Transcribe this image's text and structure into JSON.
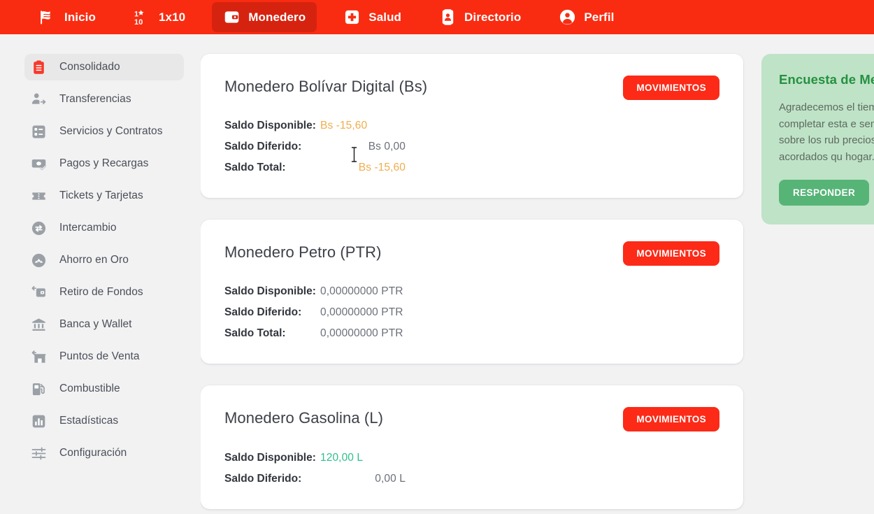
{
  "topnav": {
    "background": "#f92c11",
    "active_background": "#d62310",
    "items": [
      {
        "label": "Inicio",
        "icon": "flag-icon",
        "active": false
      },
      {
        "label": "1x10",
        "icon": "one-by-ten-icon",
        "active": false
      },
      {
        "label": "Monedero",
        "icon": "wallet-icon",
        "active": true
      },
      {
        "label": "Salud",
        "icon": "medical-cross-icon",
        "active": false
      },
      {
        "label": "Directorio",
        "icon": "id-card-icon",
        "active": false
      },
      {
        "label": "Perfil",
        "icon": "user-circle-icon",
        "active": false
      }
    ]
  },
  "sidebar": {
    "items": [
      {
        "label": "Consolidado",
        "icon": "clipboard-icon",
        "active": true
      },
      {
        "label": "Transferencias",
        "icon": "user-transfer-icon",
        "active": false
      },
      {
        "label": "Servicios y Contratos",
        "icon": "checklist-icon",
        "active": false
      },
      {
        "label": "Pagos y Recargas",
        "icon": "banknote-check-icon",
        "active": false
      },
      {
        "label": "Tickets y Tarjetas",
        "icon": "ticket-icon",
        "active": false
      },
      {
        "label": "Intercambio",
        "icon": "exchange-icon",
        "active": false
      },
      {
        "label": "Ahorro en Oro",
        "icon": "gold-savings-icon",
        "active": false
      },
      {
        "label": "Retiro de Fondos",
        "icon": "withdraw-icon",
        "active": false
      },
      {
        "label": "Banca y Wallet",
        "icon": "bank-icon",
        "active": false
      },
      {
        "label": "Puntos de Venta",
        "icon": "store-icon",
        "active": false
      },
      {
        "label": "Combustible",
        "icon": "fuel-pump-icon",
        "active": false
      },
      {
        "label": "Estadísticas",
        "icon": "bar-chart-icon",
        "active": false
      },
      {
        "label": "Configuración",
        "icon": "sliders-icon",
        "active": false
      }
    ]
  },
  "wallets": [
    {
      "title": "Monedero Bolívar Digital (Bs)",
      "action_label": "MOVIMIENTOS",
      "rows": [
        {
          "label": "Saldo Disponible:",
          "value": "Bs -15,60",
          "tone": "neg",
          "align": "left"
        },
        {
          "label": "Saldo Diferido:",
          "value": "Bs 0,00",
          "tone": "neutral",
          "align": "right"
        },
        {
          "label": "Saldo Total:",
          "value": "Bs -15,60",
          "tone": "neg",
          "align": "right"
        }
      ]
    },
    {
      "title": "Monedero Petro (PTR)",
      "action_label": "MOVIMIENTOS",
      "rows": [
        {
          "label": "Saldo Disponible:",
          "value": "0,00000000 PTR",
          "tone": "neutral",
          "align": "left"
        },
        {
          "label": "Saldo Diferido:",
          "value": "0,00000000 PTR",
          "tone": "neutral",
          "align": "left"
        },
        {
          "label": "Saldo Total:",
          "value": "0,00000000 PTR",
          "tone": "neutral",
          "align": "left"
        }
      ]
    },
    {
      "title": "Monedero Gasolina (L)",
      "action_label": "MOVIMIENTOS",
      "rows": [
        {
          "label": "Saldo Disponible:",
          "value": "120,00 L",
          "tone": "pos",
          "align": "left"
        },
        {
          "label": "Saldo Diferido:",
          "value": "0,00 L",
          "tone": "neutral",
          "align": "right"
        }
      ]
    }
  ],
  "survey": {
    "title": "Encuesta de Merca",
    "body": "Agradecemos el tiem para completar esta e semanal sobre los rub precios acordados qu hogar.",
    "button_label": "RESPONDER",
    "panel_color": "#bfe3c6",
    "title_color": "#249141",
    "button_color": "#56b477"
  },
  "cursor": {
    "type": "i-beam-text-cursor"
  }
}
